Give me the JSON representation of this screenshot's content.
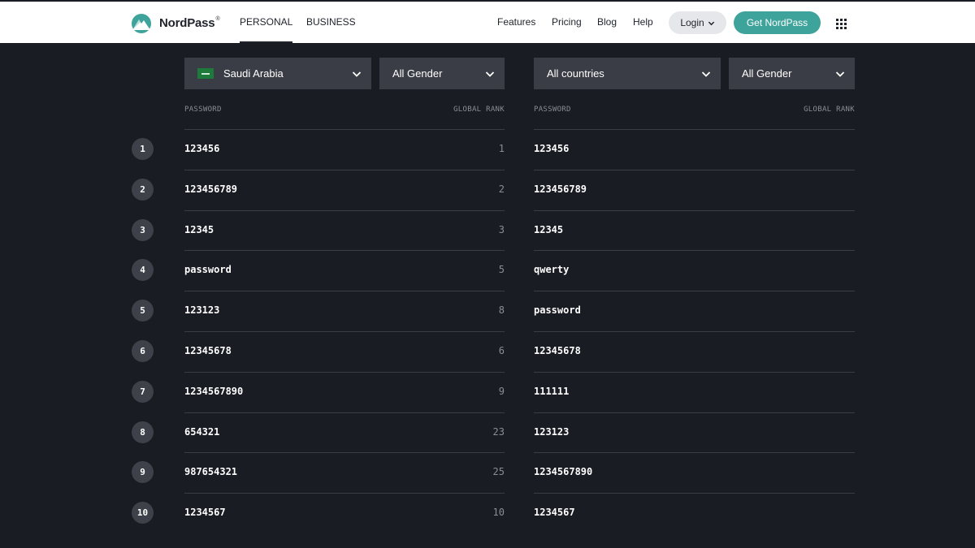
{
  "header": {
    "brand": "NordPass",
    "brand_mark": "®",
    "tabs": [
      "PERSONAL",
      "BUSINESS"
    ],
    "menu": [
      "Features",
      "Pricing",
      "Blog",
      "Help"
    ],
    "login_label": "Login",
    "cta_label": "Get NordPass"
  },
  "left_table": {
    "country": "Saudi Arabia",
    "gender": "All Gender",
    "col_password": "PASSWORD",
    "col_rank": "GLOBAL RANK",
    "rows": [
      {
        "password": "123456",
        "global_rank": "1"
      },
      {
        "password": "123456789",
        "global_rank": "2"
      },
      {
        "password": "12345",
        "global_rank": "3"
      },
      {
        "password": "password",
        "global_rank": "5"
      },
      {
        "password": "123123",
        "global_rank": "8"
      },
      {
        "password": "12345678",
        "global_rank": "6"
      },
      {
        "password": "1234567890",
        "global_rank": "9"
      },
      {
        "password": "654321",
        "global_rank": "23"
      },
      {
        "password": "987654321",
        "global_rank": "25"
      },
      {
        "password": "1234567",
        "global_rank": "10"
      }
    ]
  },
  "right_table": {
    "country": "All countries",
    "gender": "All Gender",
    "col_password": "PASSWORD",
    "col_rank": "GLOBAL RANK",
    "rows": [
      {
        "password": "123456"
      },
      {
        "password": "123456789"
      },
      {
        "password": "12345"
      },
      {
        "password": "qwerty"
      },
      {
        "password": "password"
      },
      {
        "password": "12345678"
      },
      {
        "password": "111111"
      },
      {
        "password": "123123"
      },
      {
        "password": "1234567890"
      },
      {
        "password": "1234567"
      }
    ]
  },
  "ranks": [
    "1",
    "2",
    "3",
    "4",
    "5",
    "6",
    "7",
    "8",
    "9",
    "10"
  ],
  "colors": {
    "page_bg": "#1a1c23",
    "header_bg": "#ffffff",
    "accent": "#3ea39a",
    "dropdown_bg": "#3a3d45"
  }
}
